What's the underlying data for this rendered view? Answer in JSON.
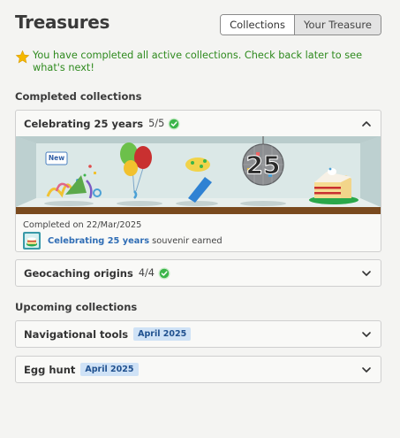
{
  "page": {
    "title": "Treasures",
    "tabs": [
      {
        "label": "Collections",
        "active": true
      },
      {
        "label": "Your Treasure",
        "active": false
      }
    ]
  },
  "notice": {
    "icon": "star-icon",
    "text": "You have completed all active collections. Check back later to see what's next!",
    "color": "#2e8a1e"
  },
  "completed": {
    "heading": "Completed collections",
    "items": [
      {
        "title": "Celebrating 25 years",
        "count": "5/5",
        "expanded": true,
        "banner_badge": "New",
        "completed_on": "Completed on 22/Mar/2025",
        "souvenir_name": "Celebrating 25 years",
        "souvenir_suffix": "souvenir earned"
      },
      {
        "title": "Geocaching origins",
        "count": "4/4",
        "expanded": false
      }
    ]
  },
  "upcoming": {
    "heading": "Upcoming collections",
    "items": [
      {
        "title": "Navigational tools",
        "badge": "April 2025"
      },
      {
        "title": "Egg hunt",
        "badge": "April 2025"
      }
    ]
  },
  "colors": {
    "success": "#2e8a1e",
    "check": "#3bb54a",
    "badge_bg": "#cfe2f6",
    "badge_text": "#20518f",
    "link": "#2f6db5"
  }
}
